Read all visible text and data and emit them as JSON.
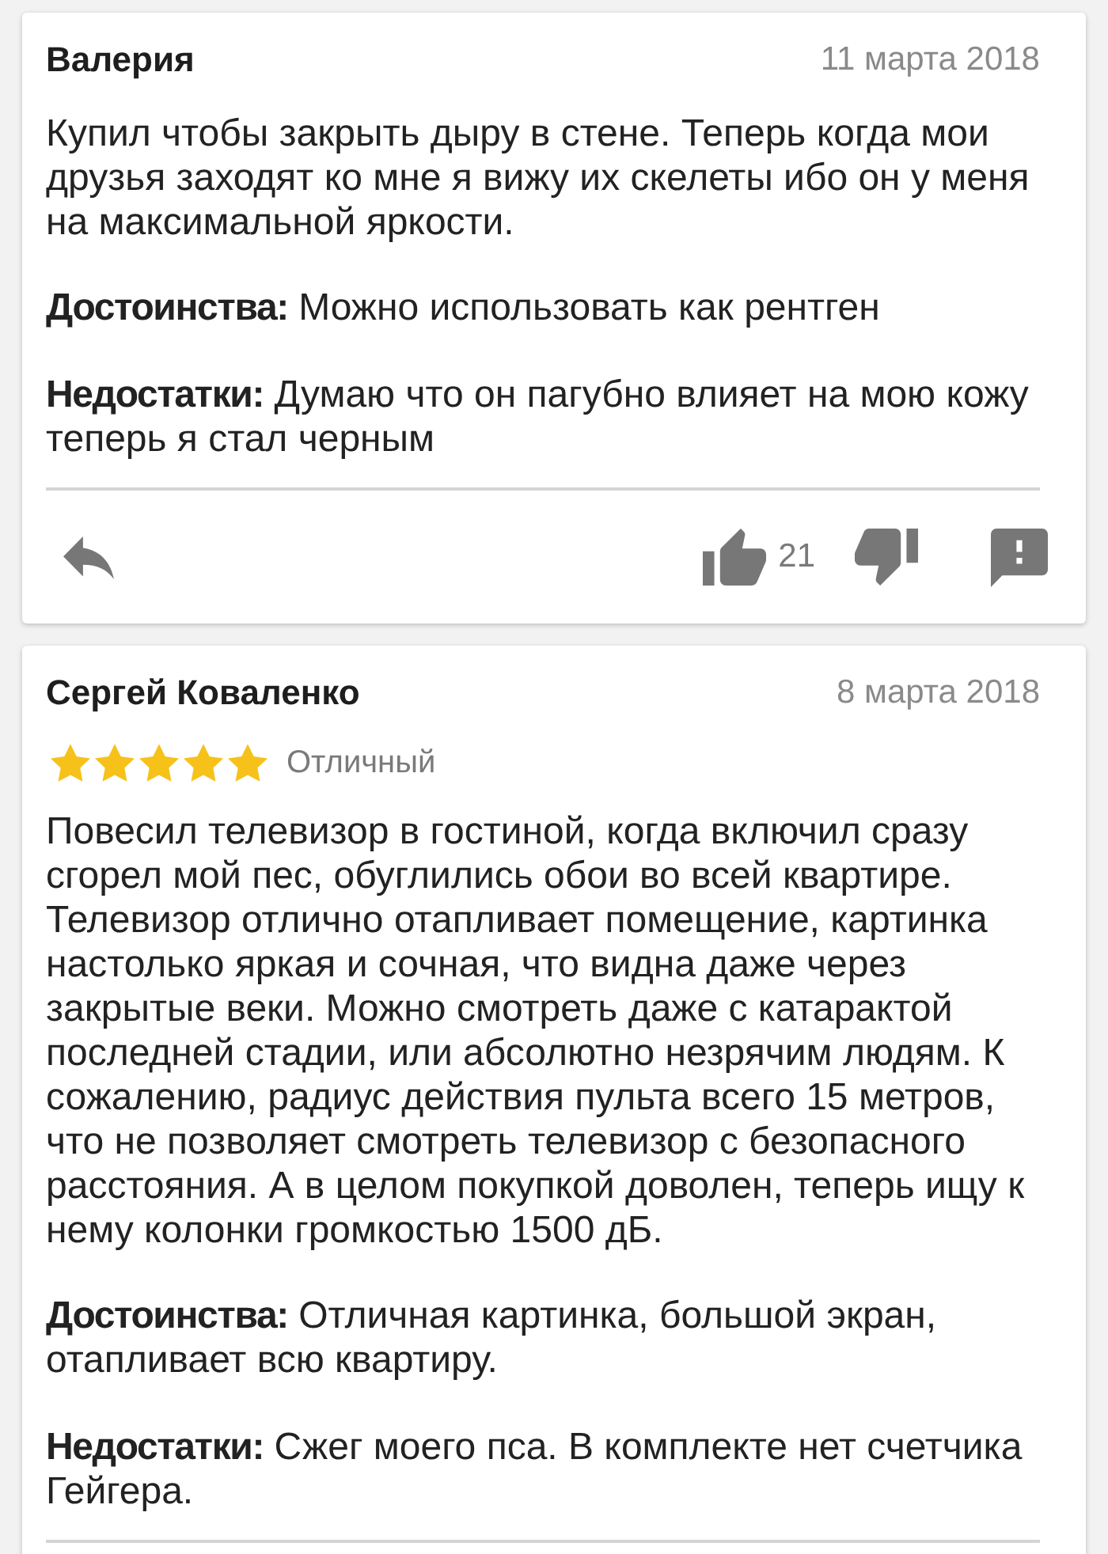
{
  "reviews": [
    {
      "author": "Валерия",
      "date": "11 марта 2018",
      "text": "Купил чтобы закрыть дыру в стене. Теперь когда мои друзья заходят ко мне я вижу их скелеты ибо он у меня на максимальной яркости.",
      "pros": "**Достоинства:** Можно использовать как рентген",
      "cons": "**Недостатки:** Думаю что он пагубно влияет на мою кожу теперь я стал черным",
      "likes": "21"
    },
    {
      "author": "Сергей Коваленко",
      "date": "8 марта 2018",
      "stars": 5,
      "rating_label": "Отличный",
      "text": "Повесил телевизор в гостиной, когда включил сразу сгорел мой пес, обуглились обои во всей квартире. Телевизор отлично отапливает помещение, картинка настолько яркая и сочная, что видна даже через закрытые веки. Можно смотреть даже с катарактой последней стадии, или абсолютно незрячим людям. К сожалению, радиус действия пульта всего 15 метров, что не позволяет смотреть телевизор с безопасного расстояния. А в целом покупкой доволен, теперь ищу к нему колонки громкостью 1500 дБ.",
      "pros": "**Достоинства:** Отличная картинка, большой экран, отапливает всю квартиру.",
      "cons": "**Недостатки:** Сжег моего пса. В комплекте нет счетчика Гейгера."
    }
  ]
}
